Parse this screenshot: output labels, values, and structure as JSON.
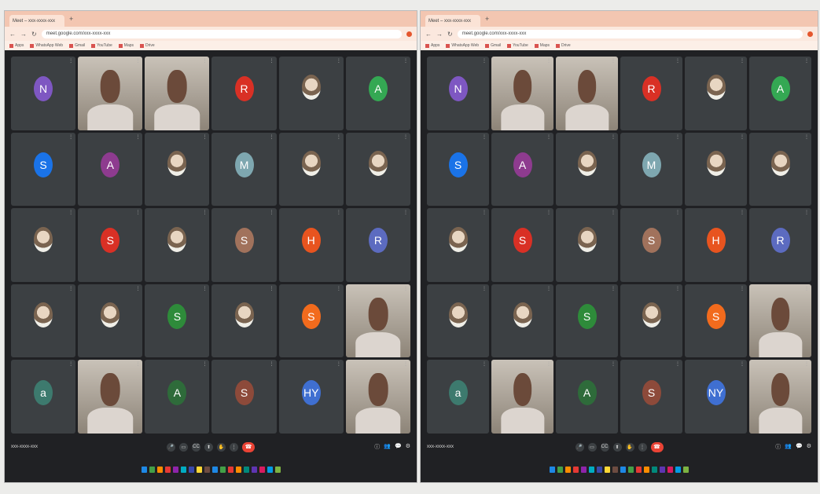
{
  "tab_title": "Meet – xxx-xxxx-xxx",
  "url": "meet.google.com/xxx-xxxx-xxx",
  "bookmarks": [
    "Apps",
    "WhatsApp Web",
    "Gmail",
    "YouTube",
    "Maps",
    "Drive"
  ],
  "meeting_code": "xxx-xxxx-xxx",
  "left_tiles": [
    {
      "letter": "N",
      "color": "#7e57c2",
      "name": "",
      "kind": "avatar"
    },
    {
      "letter": "",
      "color": "",
      "name": "",
      "kind": "video"
    },
    {
      "letter": "",
      "color": "",
      "name": "",
      "kind": "video"
    },
    {
      "letter": "R",
      "color": "#d93025",
      "name": "",
      "kind": "avatar"
    },
    {
      "letter": "",
      "color": "",
      "name": "",
      "kind": "photo"
    },
    {
      "letter": "A",
      "color": "#34a853",
      "name": "",
      "kind": "avatar"
    },
    {
      "letter": "S",
      "color": "#1a73e8",
      "name": "",
      "kind": "avatar"
    },
    {
      "letter": "A",
      "color": "#8e3b8f",
      "name": "",
      "kind": "avatar"
    },
    {
      "letter": "",
      "color": "",
      "name": "",
      "kind": "photo"
    },
    {
      "letter": "M",
      "color": "#7ea7b0",
      "name": "",
      "kind": "avatar"
    },
    {
      "letter": "",
      "color": "",
      "name": "",
      "kind": "photo"
    },
    {
      "letter": "",
      "color": "",
      "name": "",
      "kind": "photo"
    },
    {
      "letter": "",
      "color": "",
      "name": "",
      "kind": "photo"
    },
    {
      "letter": "S",
      "color": "#d93025",
      "name": "",
      "kind": "avatar"
    },
    {
      "letter": "",
      "color": "",
      "name": "",
      "kind": "photo"
    },
    {
      "letter": "S",
      "color": "#a1725c",
      "name": "",
      "kind": "avatar"
    },
    {
      "letter": "H",
      "color": "#e8541f",
      "name": "",
      "kind": "avatar"
    },
    {
      "letter": "R",
      "color": "#5c6bc0",
      "name": "",
      "kind": "avatar"
    },
    {
      "letter": "",
      "color": "",
      "name": "",
      "kind": "photo"
    },
    {
      "letter": "",
      "color": "",
      "name": "",
      "kind": "photo"
    },
    {
      "letter": "S",
      "color": "#2e8b3a",
      "name": "",
      "kind": "avatar"
    },
    {
      "letter": "",
      "color": "",
      "name": "",
      "kind": "photo"
    },
    {
      "letter": "S",
      "color": "#f26b1d",
      "name": "",
      "kind": "avatar"
    },
    {
      "letter": "",
      "color": "",
      "name": "",
      "kind": "video"
    },
    {
      "letter": "a",
      "color": "#3d7a6e",
      "name": "",
      "kind": "avatar"
    },
    {
      "letter": "",
      "color": "",
      "name": "",
      "kind": "video"
    },
    {
      "letter": "A",
      "color": "#2e6b3a",
      "name": "",
      "kind": "avatar"
    },
    {
      "letter": "S",
      "color": "#8d4a3a",
      "name": "",
      "kind": "avatar"
    },
    {
      "letter": "HY",
      "color": "#3f6fd1",
      "name": "",
      "kind": "avatar"
    },
    {
      "letter": "",
      "color": "",
      "name": "",
      "kind": "video"
    }
  ],
  "right_tiles": [
    {
      "letter": "N",
      "color": "#7e57c2",
      "name": "",
      "kind": "avatar"
    },
    {
      "letter": "",
      "color": "",
      "name": "",
      "kind": "video"
    },
    {
      "letter": "",
      "color": "",
      "name": "",
      "kind": "video"
    },
    {
      "letter": "R",
      "color": "#d93025",
      "name": "",
      "kind": "avatar"
    },
    {
      "letter": "",
      "color": "",
      "name": "",
      "kind": "photo"
    },
    {
      "letter": "A",
      "color": "#34a853",
      "name": "",
      "kind": "avatar"
    },
    {
      "letter": "S",
      "color": "#1a73e8",
      "name": "",
      "kind": "avatar"
    },
    {
      "letter": "A",
      "color": "#8e3b8f",
      "name": "",
      "kind": "avatar"
    },
    {
      "letter": "",
      "color": "",
      "name": "",
      "kind": "photo"
    },
    {
      "letter": "M",
      "color": "#7ea7b0",
      "name": "",
      "kind": "avatar"
    },
    {
      "letter": "",
      "color": "",
      "name": "",
      "kind": "photo"
    },
    {
      "letter": "",
      "color": "",
      "name": "",
      "kind": "photo"
    },
    {
      "letter": "",
      "color": "",
      "name": "",
      "kind": "photo"
    },
    {
      "letter": "S",
      "color": "#d93025",
      "name": "",
      "kind": "avatar"
    },
    {
      "letter": "",
      "color": "",
      "name": "",
      "kind": "photo"
    },
    {
      "letter": "S",
      "color": "#a1725c",
      "name": "",
      "kind": "avatar"
    },
    {
      "letter": "H",
      "color": "#e8541f",
      "name": "",
      "kind": "avatar"
    },
    {
      "letter": "R",
      "color": "#5c6bc0",
      "name": "",
      "kind": "avatar"
    },
    {
      "letter": "",
      "color": "",
      "name": "",
      "kind": "photo"
    },
    {
      "letter": "",
      "color": "",
      "name": "",
      "kind": "photo"
    },
    {
      "letter": "S",
      "color": "#2e8b3a",
      "name": "",
      "kind": "avatar"
    },
    {
      "letter": "",
      "color": "",
      "name": "",
      "kind": "photo"
    },
    {
      "letter": "S",
      "color": "#f26b1d",
      "name": "",
      "kind": "avatar"
    },
    {
      "letter": "",
      "color": "",
      "name": "",
      "kind": "video"
    },
    {
      "letter": "a",
      "color": "#3d7a6e",
      "name": "",
      "kind": "avatar"
    },
    {
      "letter": "",
      "color": "",
      "name": "",
      "kind": "video"
    },
    {
      "letter": "A",
      "color": "#2e6b3a",
      "name": "",
      "kind": "avatar"
    },
    {
      "letter": "S",
      "color": "#8d4a3a",
      "name": "",
      "kind": "avatar"
    },
    {
      "letter": "NY",
      "color": "#3f6fd1",
      "name": "",
      "kind": "avatar"
    },
    {
      "letter": "",
      "color": "",
      "name": "",
      "kind": "video"
    }
  ],
  "controls": {
    "mic": "🎤",
    "cam": "▭",
    "cc": "CC",
    "present": "⬆",
    "raise": "✋",
    "more": "⋮",
    "end": "☎"
  },
  "right_controls": [
    "ⓘ",
    "👥",
    "💬",
    "⚙"
  ],
  "taskbar_colors": [
    "#1e88e5",
    "#43a047",
    "#fb8c00",
    "#e53935",
    "#8e24aa",
    "#00acc1",
    "#3949ab",
    "#fdd835",
    "#6d4c41",
    "#1e88e5",
    "#43a047",
    "#e53935",
    "#fb8c00",
    "#00897b",
    "#5e35b1",
    "#d81b60",
    "#039be5",
    "#7cb342"
  ]
}
